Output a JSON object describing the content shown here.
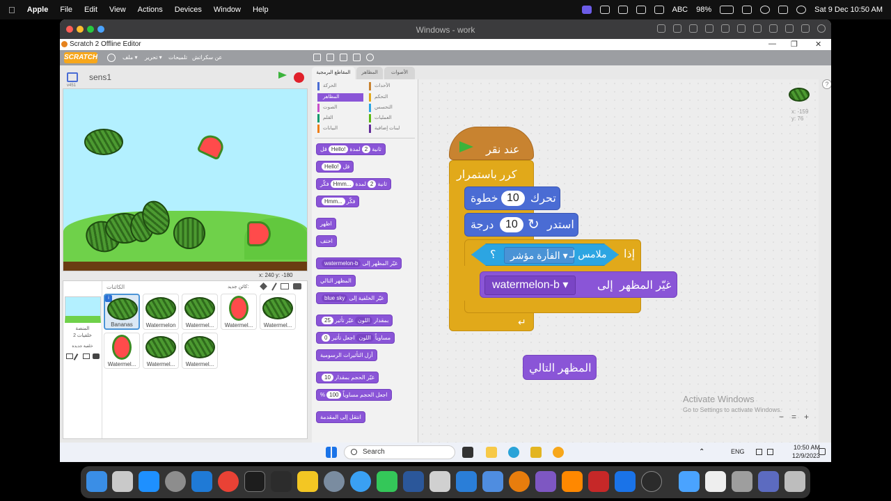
{
  "mac_menubar": {
    "app": "Apple",
    "items": [
      "Apple",
      "File",
      "Edit",
      "View",
      "Actions",
      "Devices",
      "Window",
      "Help"
    ],
    "status": {
      "keyboard": "ABC",
      "battery": "98%",
      "datetime": "Sat 9 Dec  10:50 AM"
    }
  },
  "vm_window": {
    "title": "Windows - work"
  },
  "app_window": {
    "title": "Scratch 2 Offline Editor",
    "controls": [
      "—",
      "❐",
      "✕"
    ]
  },
  "scratch_menu": {
    "logo": "SCRATCH",
    "items": [
      "ملف ▾",
      "تحرير ▾",
      "تلميحات",
      "عن سكراتش"
    ]
  },
  "stage": {
    "project_name": "sens1",
    "version": "v451",
    "coords": "x: 240   y: -180"
  },
  "sprites": {
    "header": "الكائنات",
    "new_sprite": "كائن جديد:",
    "stage_label": "المنصة",
    "stage_sub": "خلفيات 2",
    "new_backdrop": "خلفية جديدة",
    "items": [
      "Bananas",
      "Watermelon",
      "Watermel...",
      "Watermel...",
      "Watermel...",
      "Watermel...",
      "Watermel...",
      "Watermel..."
    ]
  },
  "tabs": {
    "scripts": "المقاطع البرمجية",
    "costumes": "المظاهر",
    "sounds": "الأصوات"
  },
  "categories": {
    "left": [
      "الحركة",
      "المظاهر",
      "الصوت",
      "القلم",
      "البيانات"
    ],
    "right": [
      "الأحداث",
      "التحكم",
      "التحسس",
      "العمليات",
      "لبنات إضافية"
    ]
  },
  "palette": {
    "say_secs": {
      "text": "قل",
      "value": "Hello!",
      "mid": "لمدة",
      "num": "2",
      "end": "ثانية"
    },
    "say": {
      "text": "قل",
      "value": "Hello!"
    },
    "think_secs": {
      "text": "فكّر",
      "value": "Hmm...",
      "mid": "لمدة",
      "num": "2",
      "end": "ثانية"
    },
    "think": {
      "text": "فكّر",
      "value": "Hmm..."
    },
    "show": "اظهر",
    "hide": "اختف",
    "switch_costume": {
      "text": "غيّر المظهر إلى",
      "value": "watermelon-b"
    },
    "next_costume": "المظهر التالي",
    "switch_backdrop": {
      "text": "غيّر الخلفية إلى",
      "value": "blue sky"
    },
    "change_effect": {
      "text": "غيّر تأثير",
      "effect": "اللون",
      "mid": "بمقدار",
      "num": "25"
    },
    "set_effect": {
      "text": "اجعل تأثير",
      "effect": "اللون",
      "mid": "مساوياً",
      "num": "0"
    },
    "clear_effects": "أزل التأثيرات الرسومية",
    "change_size": {
      "text": "غيّر الحجم بمقدار",
      "num": "10"
    },
    "set_size": {
      "text": "اجعل الحجم مساوياً",
      "num": "100",
      "unit": "%"
    },
    "go_front": "انتقل إلى المقدمة"
  },
  "script": {
    "hat": "عند نقر",
    "forever": "كرر باستمرار",
    "move": {
      "text": "تحرك",
      "num": "10",
      "unit": "خطوة"
    },
    "turn": {
      "text": "استدر",
      "num": "10",
      "unit": "درجة"
    },
    "if": {
      "text": "إذا",
      "sensing": "ملامس لـ",
      "target": "الفأرة مؤشر",
      "q": "؟"
    },
    "switch": {
      "text": "غيّر المظهر",
      "to": "إلى",
      "value": "watermelon-b"
    },
    "loose_block": "المظهر التالي"
  },
  "sprite_info": {
    "x": "x: -159",
    "y": "y: 76"
  },
  "watermark": {
    "line1": "Activate Windows",
    "line2": "Go to Settings to activate Windows."
  },
  "zoom": {
    "minus": "−",
    "equal": "=",
    "plus": "+"
  },
  "win_taskbar": {
    "search": "Search",
    "lang": "ENG",
    "time": "10:50 AM",
    "date": "12/9/2023"
  },
  "colors": {
    "motion": "#4a6cd4",
    "looks": "#8a55d7",
    "control": "#e1a91a",
    "events": "#c88330",
    "sensing": "#2ca5e2"
  }
}
